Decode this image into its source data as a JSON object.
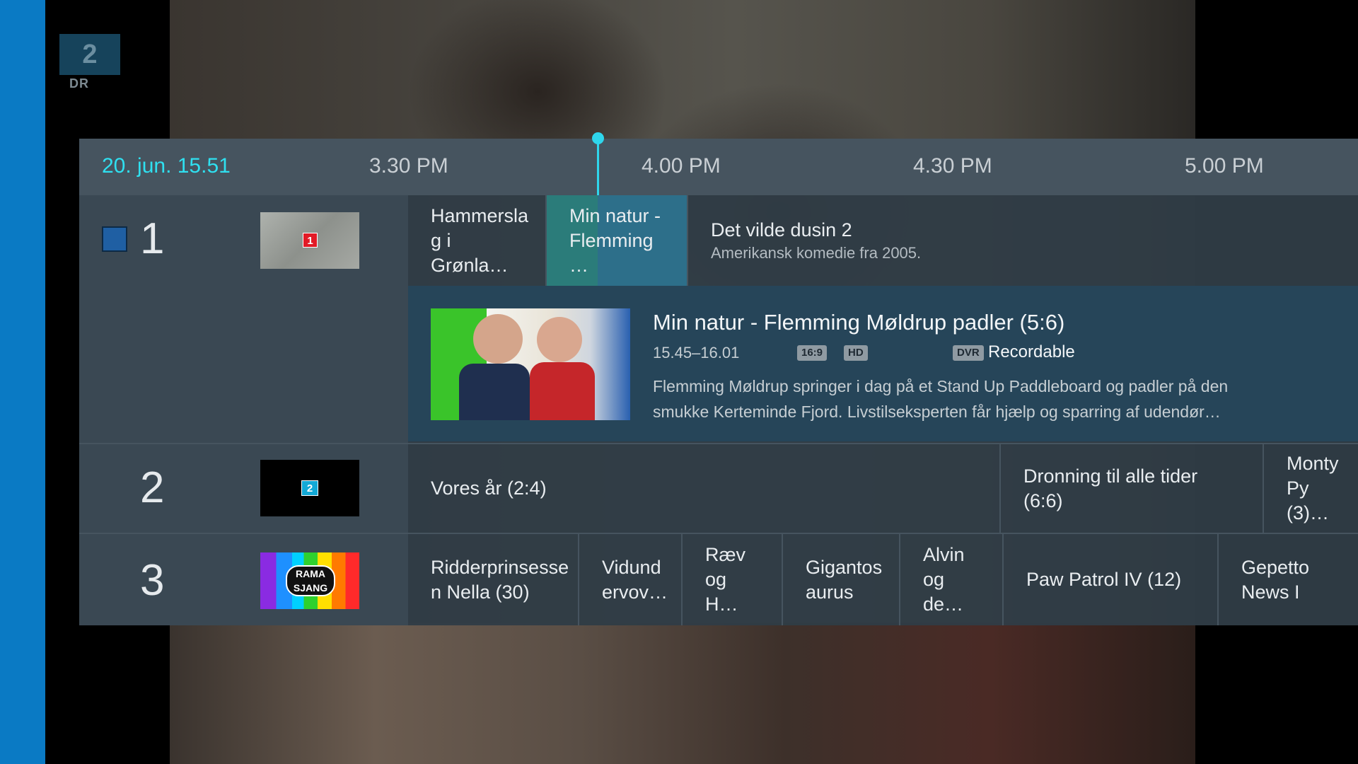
{
  "background": {
    "channel_logo_number": "2",
    "channel_logo_brand": "DR"
  },
  "timebar": {
    "date": "20. jun. 15.51",
    "ticks": [
      "3.30 PM",
      "4.00 PM",
      "4.30 PM",
      "5.00 PM"
    ]
  },
  "channels": [
    {
      "number": "1",
      "logo_badge": "1",
      "programs": [
        {
          "title": "Hammersla\ng i Grønla…"
        },
        {
          "title": "Min natur -\nFlemming …"
        },
        {
          "title": "Det vilde dusin 2",
          "subtitle": "Amerikansk komedie fra 2005."
        }
      ]
    },
    {
      "number": "2",
      "logo_badge": "2",
      "programs": [
        {
          "title": "Vores år (2:4)"
        },
        {
          "title": "Dronning til alle tider (6:6)"
        },
        {
          "title": "Monty Py\n(3)…"
        }
      ]
    },
    {
      "number": "3",
      "logo_badge": "RAMA SJANG",
      "programs": [
        {
          "title": "Ridderprinsesse\nn Nella (30)"
        },
        {
          "title": "Vidund\nervov…"
        },
        {
          "title": "Ræv\nog H…"
        },
        {
          "title": "Gigantos\naurus"
        },
        {
          "title": "Alvin\nog de…"
        },
        {
          "title": "Paw Patrol IV (12)"
        },
        {
          "title": "Gepetto News I"
        }
      ]
    }
  ],
  "detail": {
    "title": "Min natur - Flemming Møldrup padler (5:6)",
    "time": "15.45–16.01",
    "tags": [
      "16:9",
      "HD",
      "DVR"
    ],
    "recordable": "Recordable",
    "description": "Flemming Møldrup springer i dag på et Stand Up Paddleboard og padler på den smukke Kerteminde Fjord. Livstilseksperten får hjælp og sparring af udendør…"
  },
  "colors": {
    "accent": "#2fd6ec",
    "left_strip": "#0a7ac4",
    "selected_program": "#2d6f8a",
    "detail_bg": "#264559"
  }
}
